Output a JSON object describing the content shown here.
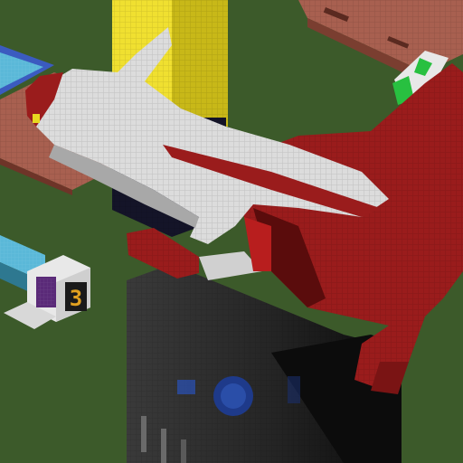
{
  "scene": {
    "colors": {
      "ground": "#3c5a2a",
      "ship_white": "#dcdcdc",
      "ship_red": "#9a1c1c",
      "ship_dark_red": "#6e1010",
      "pillar_yellow": "#e8d820",
      "tower_dark": "#2a2a2a",
      "block_navy": "#141428",
      "building_brick": "#a86050",
      "pool_blue": "#5ab8d8",
      "green_accent": "#28c040"
    },
    "hud": {
      "counter_digit": "3"
    }
  }
}
